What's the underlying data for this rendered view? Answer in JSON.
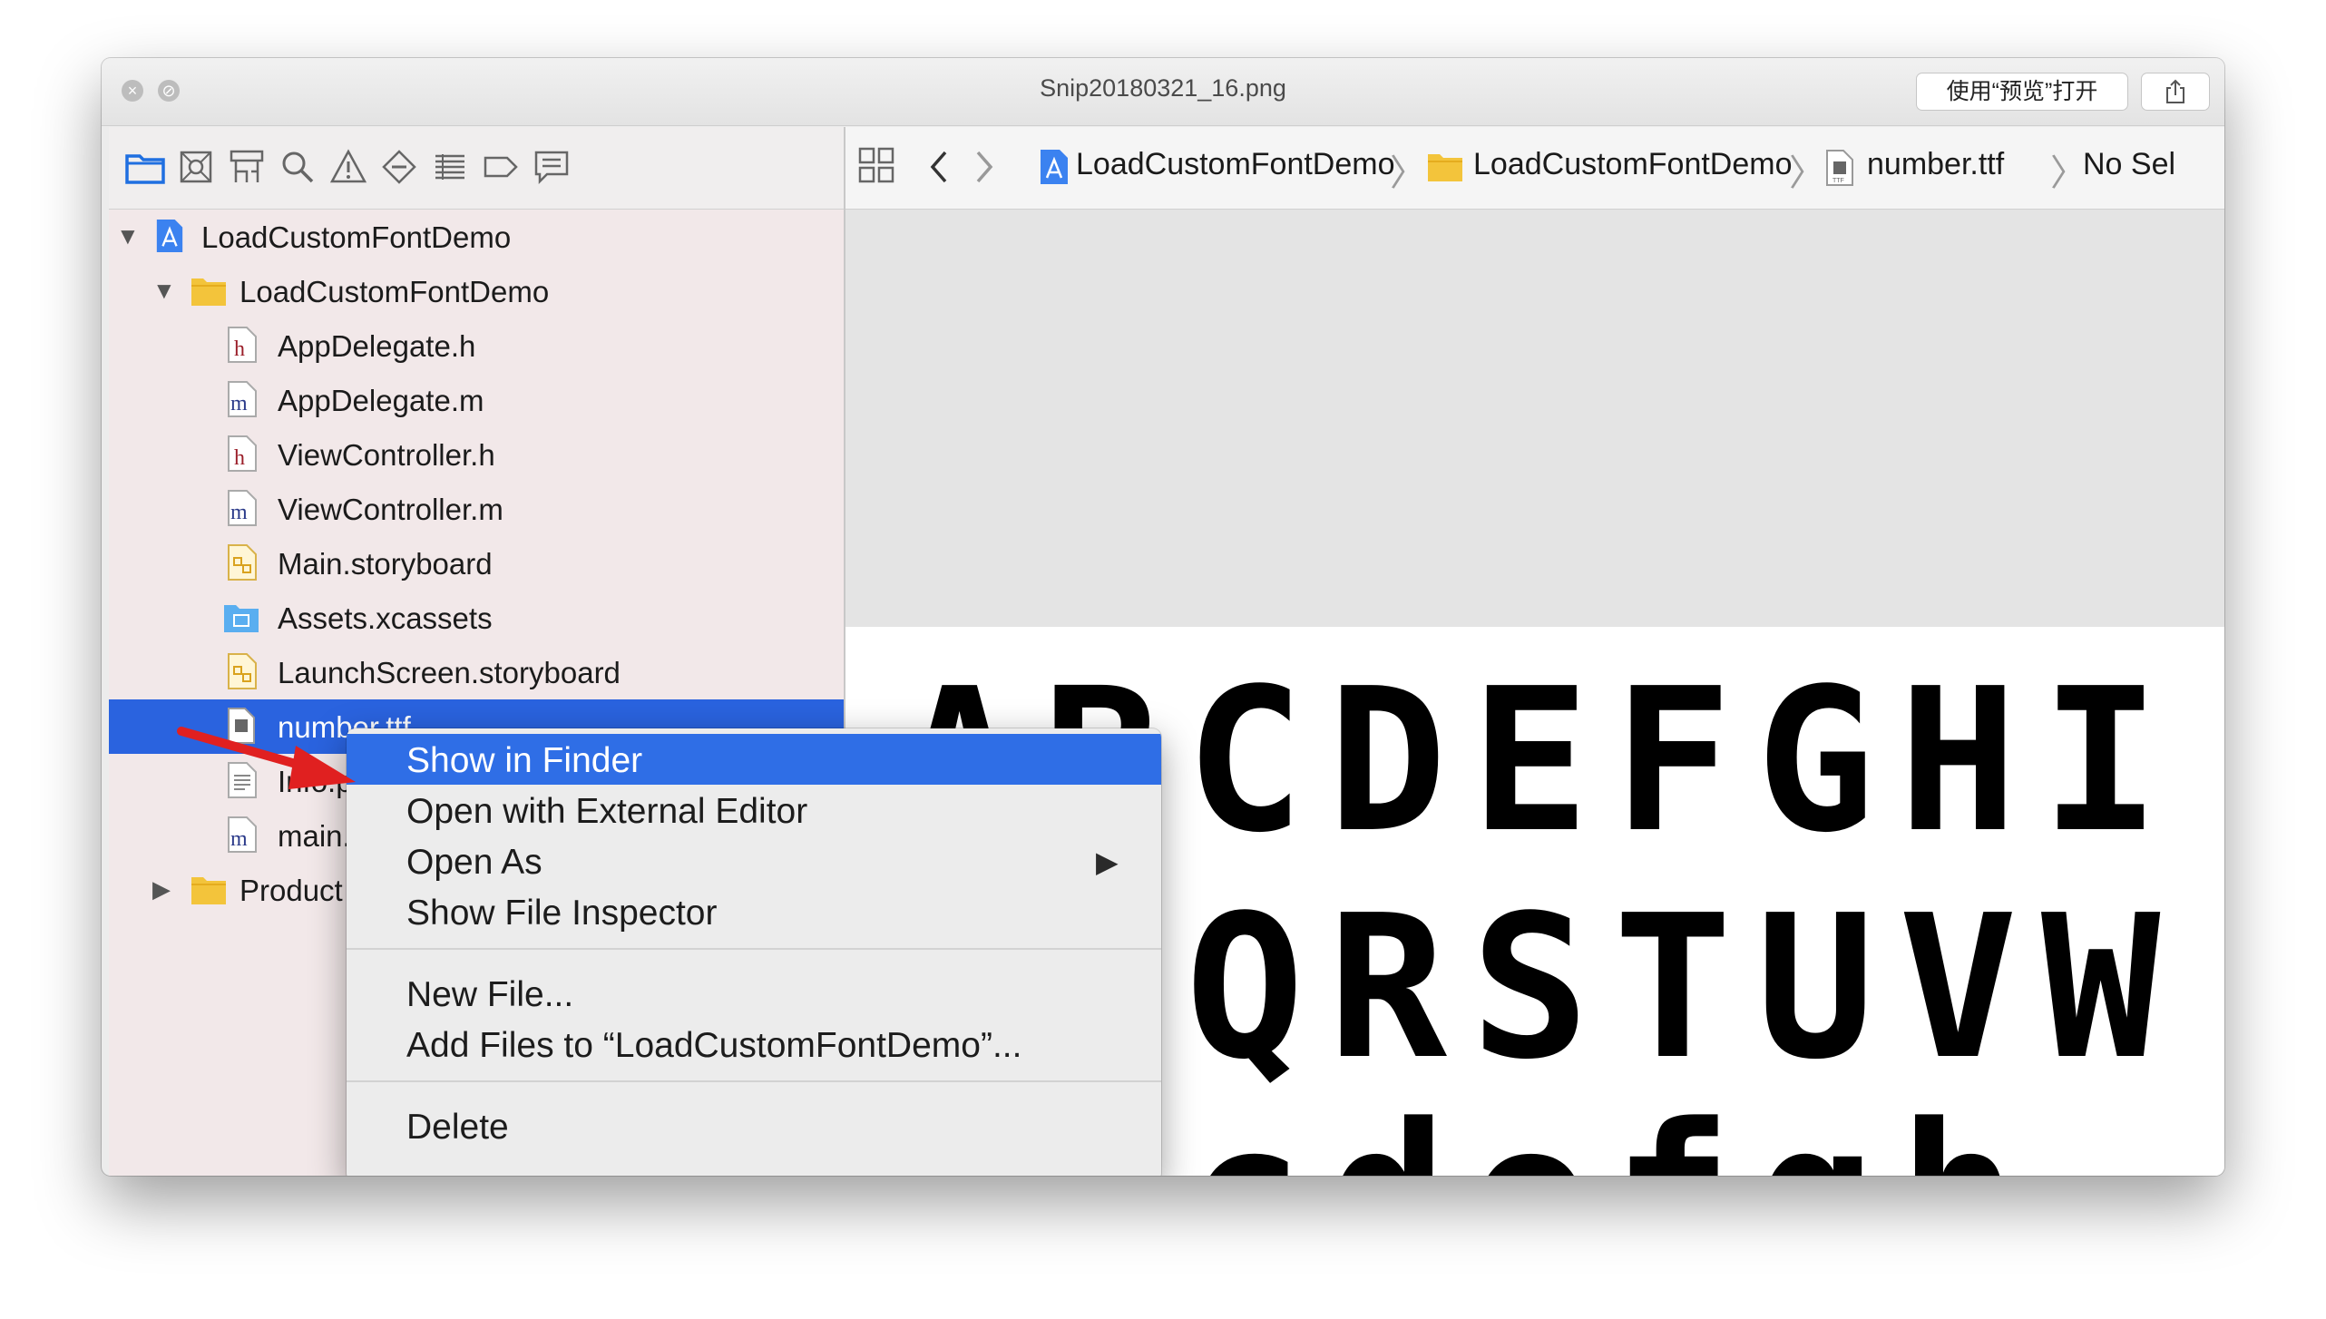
{
  "window": {
    "title": "Snip20180321_16.png",
    "open_with_label": "使用“预览”打开"
  },
  "navigator_toolbar": {
    "icons": [
      "folder-icon",
      "source-control-icon",
      "symbol-icon",
      "search-icon",
      "warning-icon",
      "test-icon",
      "debug-icon",
      "breakpoint-icon",
      "report-icon"
    ]
  },
  "jumpbar": {
    "crumbs": [
      "LoadCustomFontDemo",
      "LoadCustomFontDemo",
      "number.ttf",
      "No Sel"
    ]
  },
  "navigator": {
    "project": "LoadCustomFontDemo",
    "group": "LoadCustomFontDemo",
    "files": [
      {
        "name": "AppDelegate.h",
        "type": "h"
      },
      {
        "name": "AppDelegate.m",
        "type": "m"
      },
      {
        "name": "ViewController.h",
        "type": "h"
      },
      {
        "name": "ViewController.m",
        "type": "m"
      },
      {
        "name": "Main.storyboard",
        "type": "storyboard"
      },
      {
        "name": "Assets.xcassets",
        "type": "assets"
      },
      {
        "name": "LaunchScreen.storyboard",
        "type": "storyboard"
      },
      {
        "name": "number.ttf",
        "type": "ttf"
      },
      {
        "name": "Info.p",
        "type": "plist"
      },
      {
        "name": "main.",
        "type": "m"
      }
    ],
    "products_group": "Product",
    "file_type_letters": {
      "h": "h",
      "m": "m"
    }
  },
  "font_preview": {
    "line1": "ABCDEFGHI",
    "line2": "NPQRSTUVW",
    "line3": "abcdefgh"
  },
  "context_menu": {
    "items": [
      {
        "label": "Show in Finder",
        "highlighted": true
      },
      {
        "label": "Open with External Editor"
      },
      {
        "label": "Open As",
        "submenu": true
      },
      {
        "label": "Show File Inspector"
      },
      {
        "label": "New File..."
      },
      {
        "label": "Add Files to “LoadCustomFontDemo”..."
      },
      {
        "label": "Delete"
      }
    ],
    "submenu_arrow": "▶"
  },
  "colors": {
    "selection": "#2a63df",
    "menu_highlight": "#2f6ee6",
    "folder_yellow": "#f3c43b",
    "annotation_arrow": "#e02020",
    "toolbar_active": "#1f6fe0"
  }
}
